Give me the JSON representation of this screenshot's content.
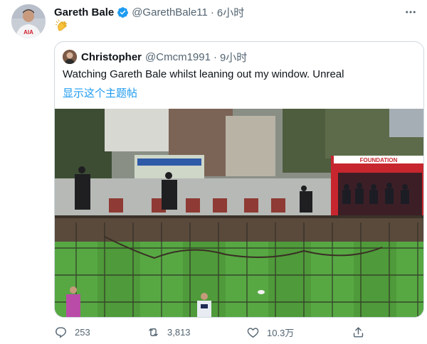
{
  "tweet": {
    "author_name": "Gareth Bale",
    "author_handle": "@GarethBale11",
    "separator": "·",
    "time": "6小时",
    "emoji": "👏",
    "avatar_kit_text": "AIA"
  },
  "quote": {
    "author_name": "Christopher",
    "author_handle": "@Cmcm1991",
    "separator": "·",
    "time": "9小时",
    "text": "Watching Gareth Bale whilst leaning out my window. Unreal",
    "show_thread": "显示这个主题帖",
    "media_sign_text": "FOUNDATION"
  },
  "actions": {
    "reply_count": "253",
    "retweet_count": "3,813",
    "like_count": "10.3万"
  },
  "colors": {
    "text": "#0f1419",
    "secondary": "#536471",
    "link": "#1d9bf0",
    "border": "#cfd9de",
    "pitch_green": "#4f9a3a"
  },
  "icons": [
    "verified-badge-icon",
    "more-options-icon",
    "reply-icon",
    "retweet-icon",
    "like-icon",
    "share-icon"
  ]
}
